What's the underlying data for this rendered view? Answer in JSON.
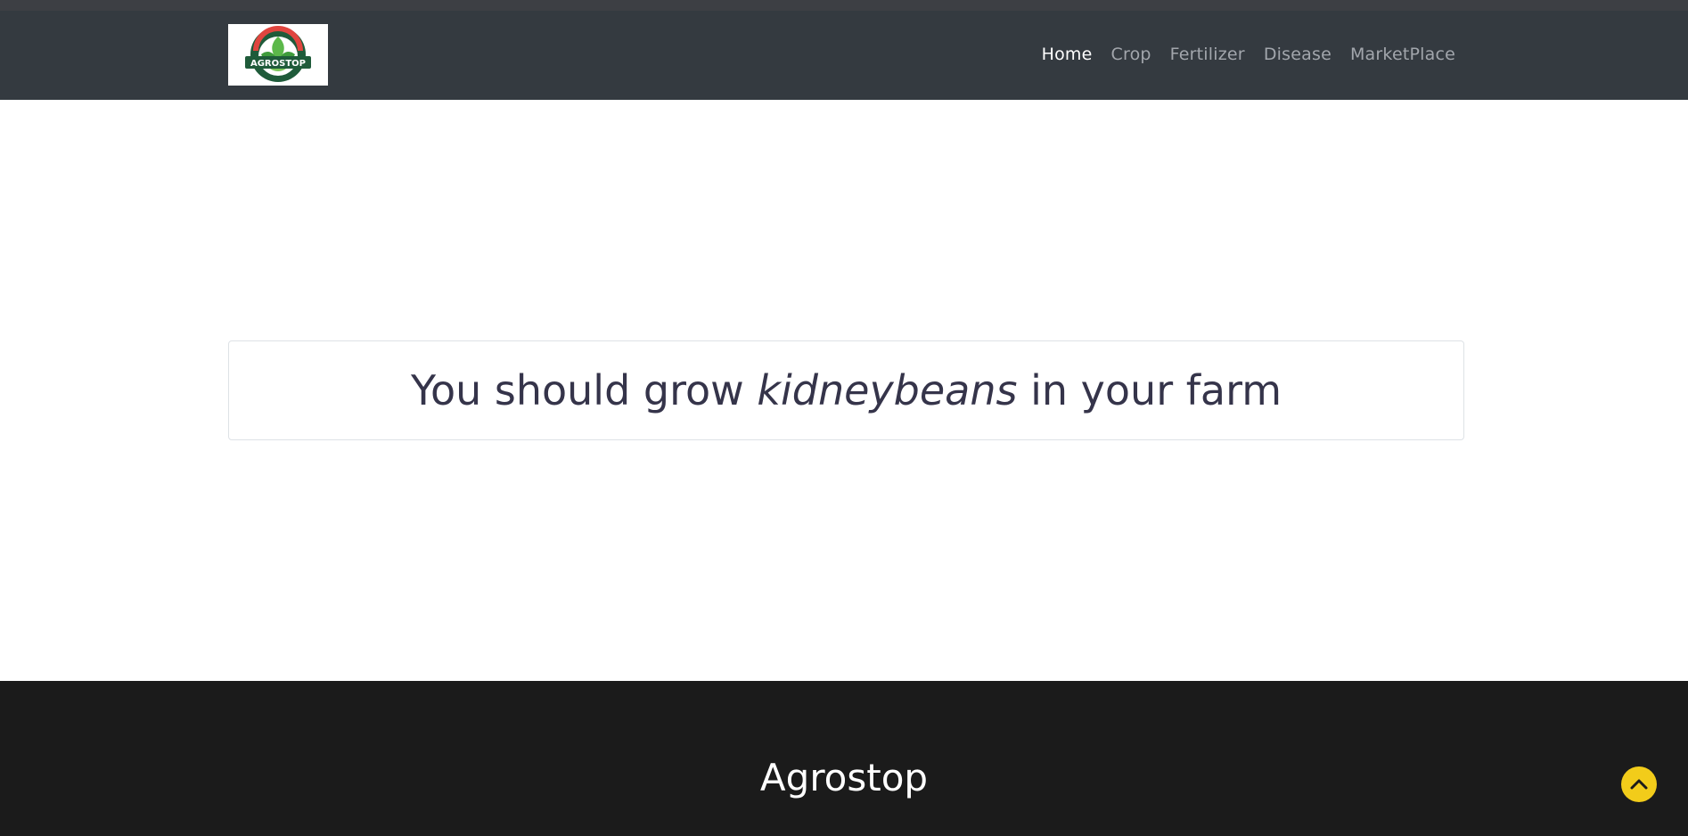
{
  "logo": {
    "text": "AGROSTOP"
  },
  "nav": {
    "items": [
      {
        "label": "Home",
        "active": true
      },
      {
        "label": "Crop",
        "active": false
      },
      {
        "label": "Fertilizer",
        "active": false
      },
      {
        "label": "Disease",
        "active": false
      },
      {
        "label": "MarketPlace",
        "active": false
      }
    ]
  },
  "result": {
    "prefix": "You should grow ",
    "crop": "kidneybeans",
    "suffix": " in your farm"
  },
  "footer": {
    "title": "Agrostop"
  },
  "icons": {
    "logo": "agrostop-logo",
    "back_to_top": "chevron-up-icon"
  },
  "colors": {
    "navbar": "#343a40",
    "footer": "#1b1b1b",
    "accent": "#f2cc1a",
    "text": "#35344a"
  }
}
